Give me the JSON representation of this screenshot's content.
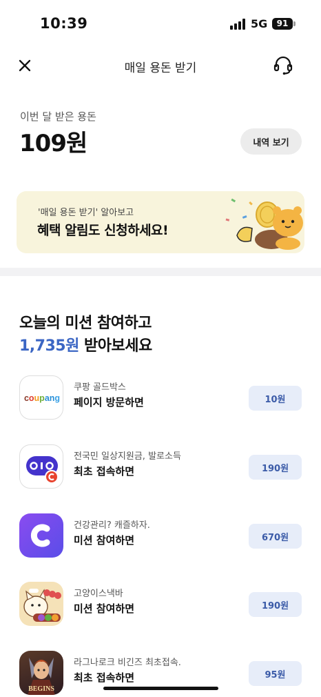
{
  "status_bar": {
    "time": "10:39",
    "network": "5G",
    "battery": "91"
  },
  "nav": {
    "title": "매일 용돈 받기",
    "close_icon": "close-icon",
    "support_icon": "headset-icon"
  },
  "balance": {
    "label": "이번 달 받은 용돈",
    "amount": "109원",
    "history_button": "내역 보기"
  },
  "banner": {
    "subtitle": "'매일 용돈 받기' 알아보고",
    "title": "혜택 알림도 신청하세요!"
  },
  "missions": {
    "heading_line1": "오늘의 미션 참여하고",
    "heading_amount": "1,735원",
    "heading_suffix": " 받아보세요",
    "items": [
      {
        "brand": "쿠팡 골드박스",
        "action": "페이지 방문하면",
        "reward": "10원",
        "icon_text": "coupang"
      },
      {
        "brand": "전국민 일상지원금, 발로소득",
        "action": "최초 접속하면",
        "reward": "190원",
        "icon_text": "OIO"
      },
      {
        "brand": "건강관리? 캐즐하자.",
        "action": "미션 참여하면",
        "reward": "670원",
        "icon_text": "C"
      },
      {
        "brand": "고양이스낵바",
        "action": "미션 참여하면",
        "reward": "190원",
        "icon_text": ""
      },
      {
        "brand": "라그나로크 비긴즈 최초접속.",
        "action": "최초 접속하면",
        "reward": "95원",
        "icon_text": "BEGINS"
      }
    ]
  },
  "colors": {
    "accent": "#3b66c4",
    "reward_bg": "#e7edf9",
    "banner_bg": "#f8f4dc"
  }
}
